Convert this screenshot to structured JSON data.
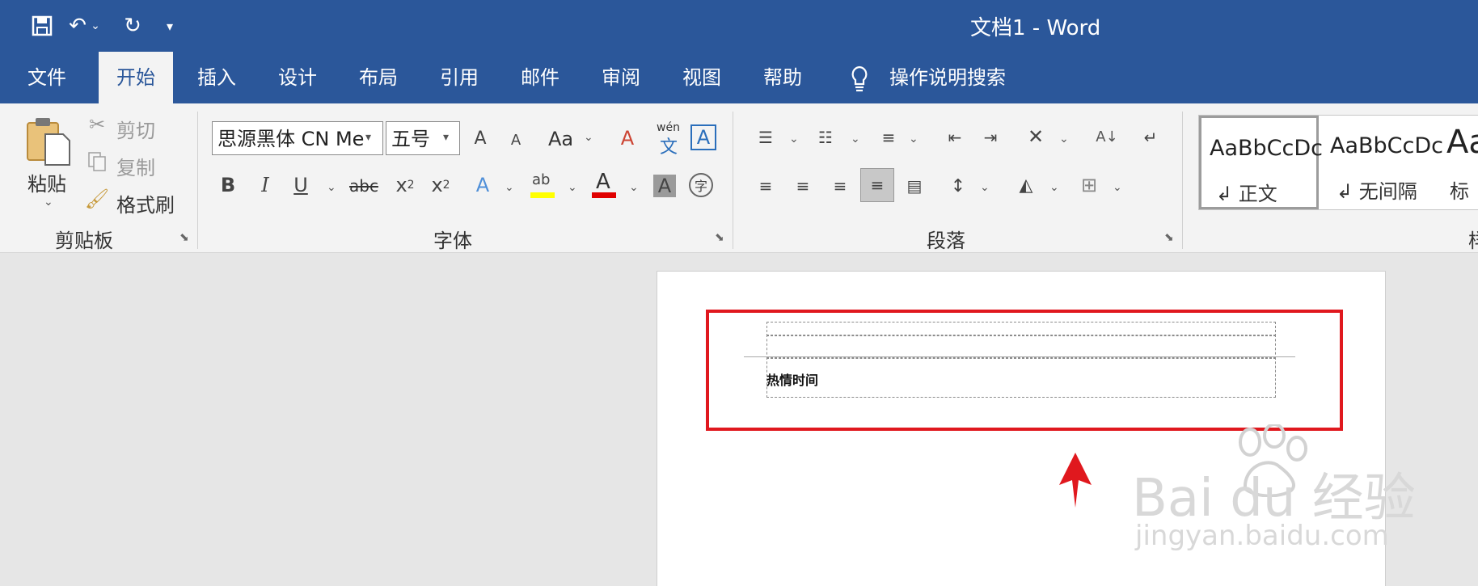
{
  "window": {
    "title": "文档1  -  Word"
  },
  "tabs": [
    {
      "label": "文件"
    },
    {
      "label": "开始",
      "active": true
    },
    {
      "label": "插入"
    },
    {
      "label": "设计"
    },
    {
      "label": "布局"
    },
    {
      "label": "引用"
    },
    {
      "label": "邮件"
    },
    {
      "label": "审阅"
    },
    {
      "label": "视图"
    },
    {
      "label": "帮助"
    }
  ],
  "tell_me": {
    "label": "操作说明搜索"
  },
  "clipboard": {
    "paste_label": "粘贴",
    "cut_label": "剪切",
    "copy_label": "复制",
    "format_painter_label": "格式刷",
    "group_label": "剪贴板"
  },
  "font": {
    "font_name": "思源黑体 CN Me",
    "font_size": "五号",
    "change_case_label": "Aa",
    "strikethrough_label": "abc",
    "phonetic_label": "wén",
    "phonetic_char": "文",
    "enclose_char": "字",
    "group_label": "字体"
  },
  "paragraph": {
    "group_label": "段落"
  },
  "styles": {
    "items": [
      {
        "sample": "AaBbCcDc",
        "name": "正文"
      },
      {
        "sample": "AaBbCcDc",
        "name": "无间隔"
      },
      {
        "sample": "Aa",
        "name": "标"
      }
    ],
    "group_label_partial": "样"
  },
  "document": {
    "header_text": "热情时间"
  },
  "watermark": {
    "brand": "Bai  du 经验",
    "url": "jingyan.baidu.com"
  },
  "colors": {
    "title_bar": "#2b579a",
    "ribbon": "#f3f3f3",
    "highlight": "#e0181e",
    "highlight_yellow": "#ffff00",
    "font_red": "#e00000"
  }
}
